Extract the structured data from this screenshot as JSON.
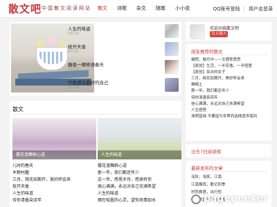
{
  "header": {
    "logo": "散文吧",
    "slogan": "中国散文阅读网站",
    "nav": [
      "散文",
      "诗歌",
      "杂文",
      "随笔",
      "小小说"
    ],
    "qq_login": "QQ账号登陆",
    "username_login": "用户名登录",
    "separator": "|"
  },
  "featured": {
    "items": [
      {
        "title": "人生的味道",
        "date": "03-20"
      },
      {
        "title": "枝开天香",
        "date": "03-21"
      },
      {
        "title": "馥香一樽寄语春天",
        "date": "03-22"
      },
      {
        "title": "只愿遇见最好的自己",
        "date": "03-24"
      }
    ]
  },
  "essays": {
    "section_title": "散文",
    "pictures": [
      {
        "caption": "樱花漫舞醉心语"
      },
      {
        "caption": "人生的味道"
      }
    ],
    "left_list": [
      "儿时的春天",
      "乡野村趣",
      "三月，桃花如期开，美好终会来",
      "枝开天香",
      "人生的味道",
      "待你清香染流年"
    ],
    "right_list": [
      "樱花漫舞醉心语",
      "那一年，我们都还年少",
      "这一世，感恩岁月，感谢有你",
      "很心满满，永远对自己充满希望",
      "人生的味道",
      "肆在喧嚣的心灵，望你风情如水"
    ]
  },
  "sidebar": {
    "welcome": "欢迎光临散文吧",
    "login_button": "马上加入",
    "recommend_title": "阅友推荐的散文",
    "recommend_list": [
      "编程，做月中——文理草思思",
      "【原创】生活，一半安逸，一半喧嚣",
      "【原创】如冰的女子",
      "三月，桃花如期开，美好终会来",
      "稀楠土",
      "那一年，我们都还年少",
      "待你清香染流年",
      "信心满满，永远对自己充满希望",
      "人生感悟",
      "清明蓝绿 不要因为世界而选择遗世孤风"
    ],
    "weekly_title": "过去7日阅读榜",
    "latest_title": "最新发布的文章",
    "latest_list": [
      "深秋，浅笑，江南",
      "江南烟雨，散记四季",
      "村色晚意，出行愁",
      "【原创】漂泊的灵魂"
    ]
  },
  "watermark": {
    "text": "pagepeeker"
  },
  "colors": {
    "accent": "#c9373d",
    "button": "#d9453c",
    "background": "#f3f3f3"
  }
}
